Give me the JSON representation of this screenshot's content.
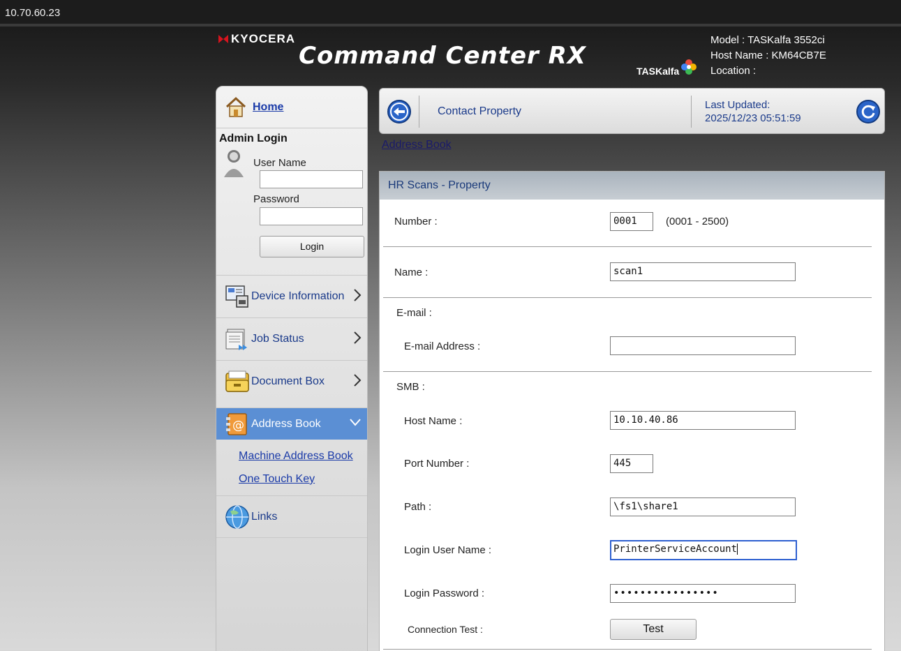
{
  "browser": {
    "address": "10.70.60.23"
  },
  "header": {
    "brand": "KYOCERA",
    "product": "Command Center RX",
    "product_line": "TASKalfa",
    "model": "Model : TASKalfa 3552ci",
    "host_name": "Host Name : KM64CB7E",
    "location": "Location :"
  },
  "sidebar": {
    "home": "Home",
    "admin_login": "Admin Login",
    "user_name_label": "User Name",
    "password_label": "Password",
    "login_button": "Login",
    "nav": [
      {
        "label": "Device Information",
        "icon": "device-information-icon"
      },
      {
        "label": "Job Status",
        "icon": "job-status-icon"
      },
      {
        "label": "Document Box",
        "icon": "document-box-icon"
      },
      {
        "label": "Address Book",
        "icon": "address-book-icon"
      },
      {
        "label": "Links",
        "icon": "globe-icon"
      }
    ],
    "sub_links": [
      "Machine Address Book",
      "One Touch Key"
    ]
  },
  "mainbar": {
    "title": "Contact Property",
    "last_updated_label": "Last Updated:",
    "last_updated_value": "2025/12/23 05:51:59"
  },
  "breadcrumb": "Address Book",
  "panel": {
    "title": "HR Scans - Property",
    "number_label": "Number :",
    "number_value": "0001",
    "number_range": "(0001 - 2500)",
    "name_label": "Name :",
    "name_value": "scan1",
    "email_section": "E-mail :",
    "email_label": "E-mail Address :",
    "email_value": "",
    "smb_section": "SMB :",
    "host_label": "Host Name :",
    "host_value": "10.10.40.86",
    "port_label": "Port Number :",
    "port_value": "445",
    "path_label": "Path :",
    "path_value": "\\fs1\\share1",
    "login_user_label": "Login User Name :",
    "login_user_value": "PrinterServiceAccount",
    "login_password_label": "Login Password :",
    "login_password_value": "••••••••••••••••",
    "connection_test_label": "Connection Test :",
    "test_button": "Test"
  },
  "colors": {
    "link": "#1a3aa8",
    "active_nav": "#5b8fd4",
    "panel_head": "#a9b3bd",
    "focus_border": "#2d5fd0"
  }
}
